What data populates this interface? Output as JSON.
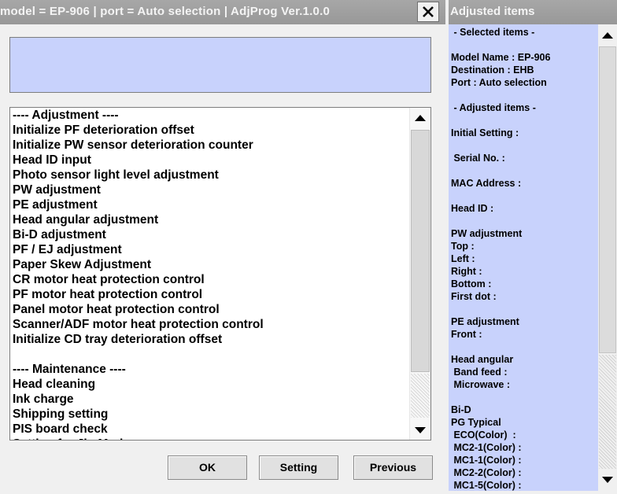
{
  "window": {
    "title": "model = EP-906 | port = Auto selection | AdjProg Ver.1.0.0"
  },
  "status_box": {
    "text": ""
  },
  "adjustment_list": {
    "items": [
      "---- Adjustment ----",
      "Initialize PF deterioration offset",
      "Initialize PW sensor deterioration counter",
      "Head ID input",
      "Photo sensor light level adjustment",
      "PW adjustment",
      "PE adjustment",
      "Head angular adjustment",
      "Bi-D adjustment",
      "PF / EJ adjustment",
      "Paper Skew Adjustment",
      "CR motor heat protection control",
      "PF motor heat protection control",
      "Panel motor heat protection control",
      "Scanner/ADF motor heat protection control",
      "Initialize CD tray deterioration offset",
      "",
      "---- Maintenance ----",
      "Head cleaning",
      "Ink charge",
      "Shipping setting",
      "PIS board check",
      "Setting for Jig Mode"
    ]
  },
  "buttons": {
    "ok": "OK",
    "setting": "Setting",
    "previous": "Previous"
  },
  "adjusted_panel": {
    "title": "Adjusted items",
    "lines": [
      " - Selected items -",
      "",
      "Model Name : EP-906",
      "Destination : EHB",
      "Port : Auto selection",
      "",
      " - Adjusted items -",
      "",
      "Initial Setting :",
      "",
      " Serial No. :",
      "",
      "MAC Address :",
      "",
      "Head ID :",
      "",
      "PW adjustment",
      "Top :",
      "Left :",
      "Right :",
      "Bottom :",
      "First dot :",
      "",
      "PE adjustment",
      "Front :",
      "",
      "Head angular",
      " Band feed :",
      " Microwave :",
      "",
      "Bi-D",
      "PG Typical",
      " ECO(Color)  :",
      " MC2-1(Color) :",
      " MC1-1(Color) :",
      " MC2-2(Color) :",
      " MC1-5(Color) :"
    ]
  }
}
